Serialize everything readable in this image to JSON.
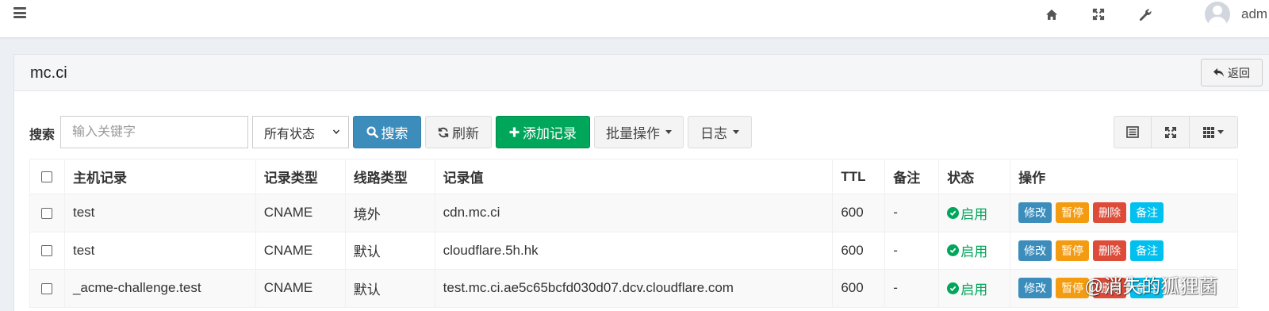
{
  "header": {
    "username": "adm",
    "icons": [
      "menu-icon",
      "home-icon",
      "fullscreen-icon",
      "wrench-icon",
      "avatar"
    ]
  },
  "panel": {
    "title": "mc.ci",
    "back_label": "返回"
  },
  "toolbar": {
    "search_label": "搜索",
    "keyword_placeholder": "输入关键字",
    "status_value": "所有状态",
    "search_button": "搜索",
    "refresh_button": "刷新",
    "add_button": "添加记录",
    "batch_button": "批量操作",
    "log_button": "日志"
  },
  "table": {
    "columns": [
      "主机记录",
      "记录类型",
      "线路类型",
      "记录值",
      "TTL",
      "备注",
      "状态",
      "操作"
    ],
    "rows": [
      {
        "host": "test",
        "type": "CNAME",
        "line": "境外",
        "value": "cdn.mc.ci",
        "ttl": "600",
        "note": "-",
        "status": "启用"
      },
      {
        "host": "test",
        "type": "CNAME",
        "line": "默认",
        "value": "cloudflare.5h.hk",
        "ttl": "600",
        "note": "-",
        "status": "启用"
      },
      {
        "host": "_acme-challenge.test",
        "type": "CNAME",
        "line": "默认",
        "value": "test.mc.ci.ae5c65bcfd030d07.dcv.cloudflare.com",
        "ttl": "600",
        "note": "-",
        "status": "启用"
      }
    ],
    "actions": {
      "edit": "修改",
      "pause": "暂停",
      "delete": "删除",
      "note": "备注"
    }
  },
  "watermark": "@消失的狐狸菌",
  "colors": {
    "primary": "#3c8dbc",
    "success": "#00a65a",
    "warning": "#f39c12",
    "danger": "#dd4b39",
    "info": "#00c0ef"
  }
}
